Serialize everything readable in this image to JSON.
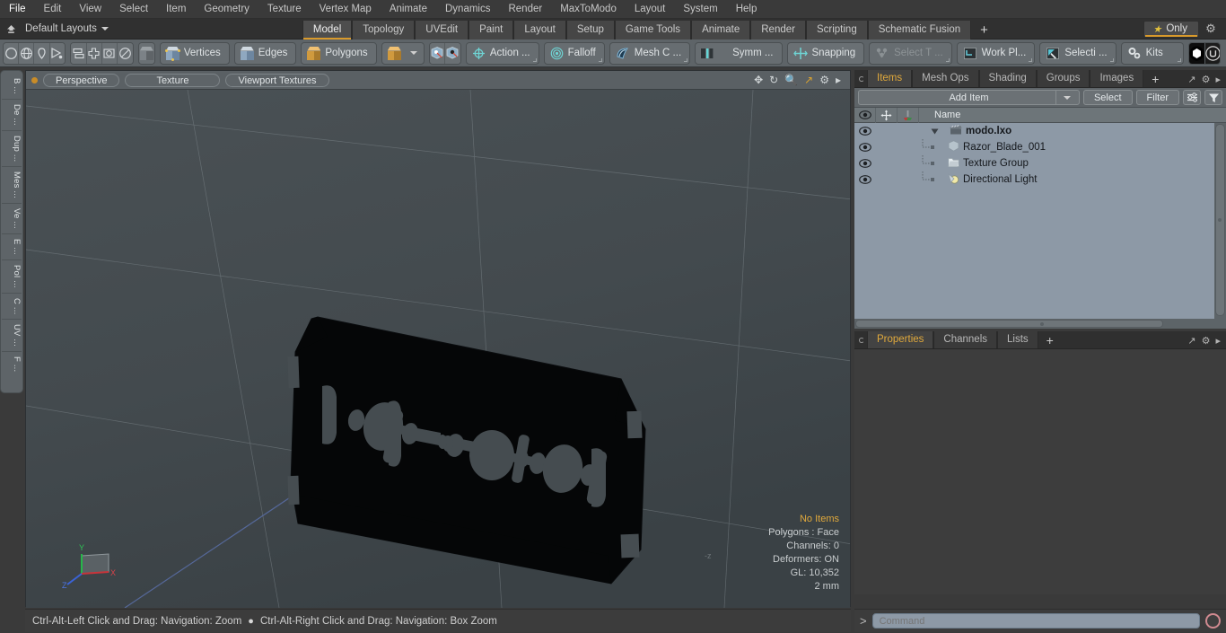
{
  "menubar": {
    "items": [
      "File",
      "Edit",
      "View",
      "Select",
      "Item",
      "Geometry",
      "Texture",
      "Vertex Map",
      "Animate",
      "Dynamics",
      "Render",
      "MaxToModo",
      "Layout",
      "System",
      "Help"
    ]
  },
  "layoutbar": {
    "home_icon": "home-up-arrow-icon",
    "layouts_label": "Default Layouts",
    "tabs": [
      {
        "label": "Model",
        "active": true
      },
      {
        "label": "Topology",
        "active": false
      },
      {
        "label": "UVEdit",
        "active": false
      },
      {
        "label": "Paint",
        "active": false
      },
      {
        "label": "Layout",
        "active": false
      },
      {
        "label": "Setup",
        "active": false
      },
      {
        "label": "Game Tools",
        "active": false
      },
      {
        "label": "Animate",
        "active": false
      },
      {
        "label": "Render",
        "active": false
      },
      {
        "label": "Scripting",
        "active": false
      },
      {
        "label": "Schematic Fusion",
        "active": false
      }
    ],
    "add_tab_label": "+",
    "only_label": "Only",
    "accent_color": "#d99a2b"
  },
  "toolbar": {
    "shape_tools": [
      "circle-icon",
      "globe-icon",
      "pen-icon",
      "curve-icon"
    ],
    "align_tools": [
      "mirror-icon",
      "center-icon",
      "box-select-icon",
      "radial-icon"
    ],
    "solid_icon": "solid-cube-icon",
    "selection_modes": [
      {
        "label": "Vertices",
        "icon": "cube-vertices-icon"
      },
      {
        "label": "Edges",
        "icon": "cube-edges-icon"
      },
      {
        "label": "Polygons",
        "icon": "cube-polygons-icon"
      }
    ],
    "mode_dropdown_icon": "chevron-down-icon",
    "snap_toggles": [
      "snap-vertex-icon",
      "snap-element-icon"
    ],
    "items": [
      {
        "label": "Action  ...",
        "icon": "action-center-icon",
        "dim": false
      },
      {
        "label": "Falloff",
        "icon": "falloff-icon",
        "dim": false
      },
      {
        "label": "Mesh C ...",
        "icon": "mesh-constraint-icon",
        "dim": false
      },
      {
        "label": "Symm ...",
        "icon": "symmetry-icon",
        "dim": false
      },
      {
        "label": "Snapping",
        "icon": "snapping-icon",
        "dim": false
      },
      {
        "label": "Select T ...",
        "icon": "select-through-icon",
        "dim": true
      },
      {
        "label": "Work Pl...",
        "icon": "work-plane-icon",
        "dim": false
      },
      {
        "label": "Selecti  ...",
        "icon": "selection-set-icon",
        "dim": false
      }
    ],
    "kits_label": "Kits",
    "kits_icon": "gears-icon",
    "right_icons": [
      "modo-badge-icon",
      "unreal-badge-icon"
    ]
  },
  "left_tabs": {
    "items": [
      "B ...",
      "De ...",
      "Dup ...",
      "Mes ...",
      "Ve ...",
      "E ...",
      "Pol ...",
      "C ...",
      "UV ...",
      "F ..."
    ]
  },
  "viewport": {
    "pills": [
      "Perspective",
      "Texture",
      "Viewport Textures"
    ],
    "header_icons": [
      "pan-icon",
      "rotate-icon",
      "zoom-icon",
      "fit-icon",
      "gear-icon",
      "chevron-right-icon"
    ],
    "info": {
      "selection": "No Items",
      "polygons": "Polygons : Face",
      "channels": "Channels: 0",
      "deformers": "Deformers: ON",
      "gl": "GL: 10,352",
      "scale": "2 mm"
    },
    "info_highlight_color": "#e0a93c",
    "gizmo": {
      "x": "X",
      "y": "Y",
      "z": "Z"
    },
    "axis_label_neg_z": "-z",
    "model_name": "razor-blade-mesh"
  },
  "statusbar": {
    "left_hint": "Ctrl-Alt-Left Click and Drag: Navigation: Zoom",
    "separator": "●",
    "right_hint": "Ctrl-Alt-Right Click and Drag: Navigation: Box Zoom"
  },
  "right_panel": {
    "top_tabs": [
      {
        "label": "Items",
        "active": true
      },
      {
        "label": "Mesh Ops",
        "active": false
      },
      {
        "label": "Shading",
        "active": false
      },
      {
        "label": "Groups",
        "active": false
      },
      {
        "label": "Images",
        "active": false
      }
    ],
    "top_tabs_plus": "+",
    "items_toolbar": {
      "add_item_label": "Add Item",
      "dropdown_icon": "chevron-down-icon",
      "select_label": "Select",
      "filter_label": "Filter",
      "options_icon": "sliders-icon",
      "funnel_icon": "funnel-icon"
    },
    "list_header": {
      "col_eye": "eye-icon",
      "col_lock": "move-icon",
      "col_shade": "shading-icon",
      "col_name": "Name"
    },
    "tree": [
      {
        "label": "modo.lxo",
        "icon": "scene-icon",
        "depth": 0,
        "root": true,
        "expanded": true
      },
      {
        "label": "Razor_Blade_001",
        "icon": "mesh-icon",
        "depth": 1,
        "root": false
      },
      {
        "label": "Texture Group",
        "icon": "folder-icon",
        "depth": 1,
        "root": false
      },
      {
        "label": "Directional Light",
        "icon": "light-icon",
        "depth": 1,
        "root": false
      }
    ],
    "bottom_tabs": [
      {
        "label": "Properties",
        "active": true
      },
      {
        "label": "Channels",
        "active": false
      },
      {
        "label": "Lists",
        "active": false
      }
    ],
    "bottom_tabs_plus": "+",
    "accent_color": "#e0a93c"
  },
  "command_bar": {
    "prompt": "&gt;",
    "placeholder": "Command",
    "value": "",
    "record_icon": "record-circle-icon"
  }
}
